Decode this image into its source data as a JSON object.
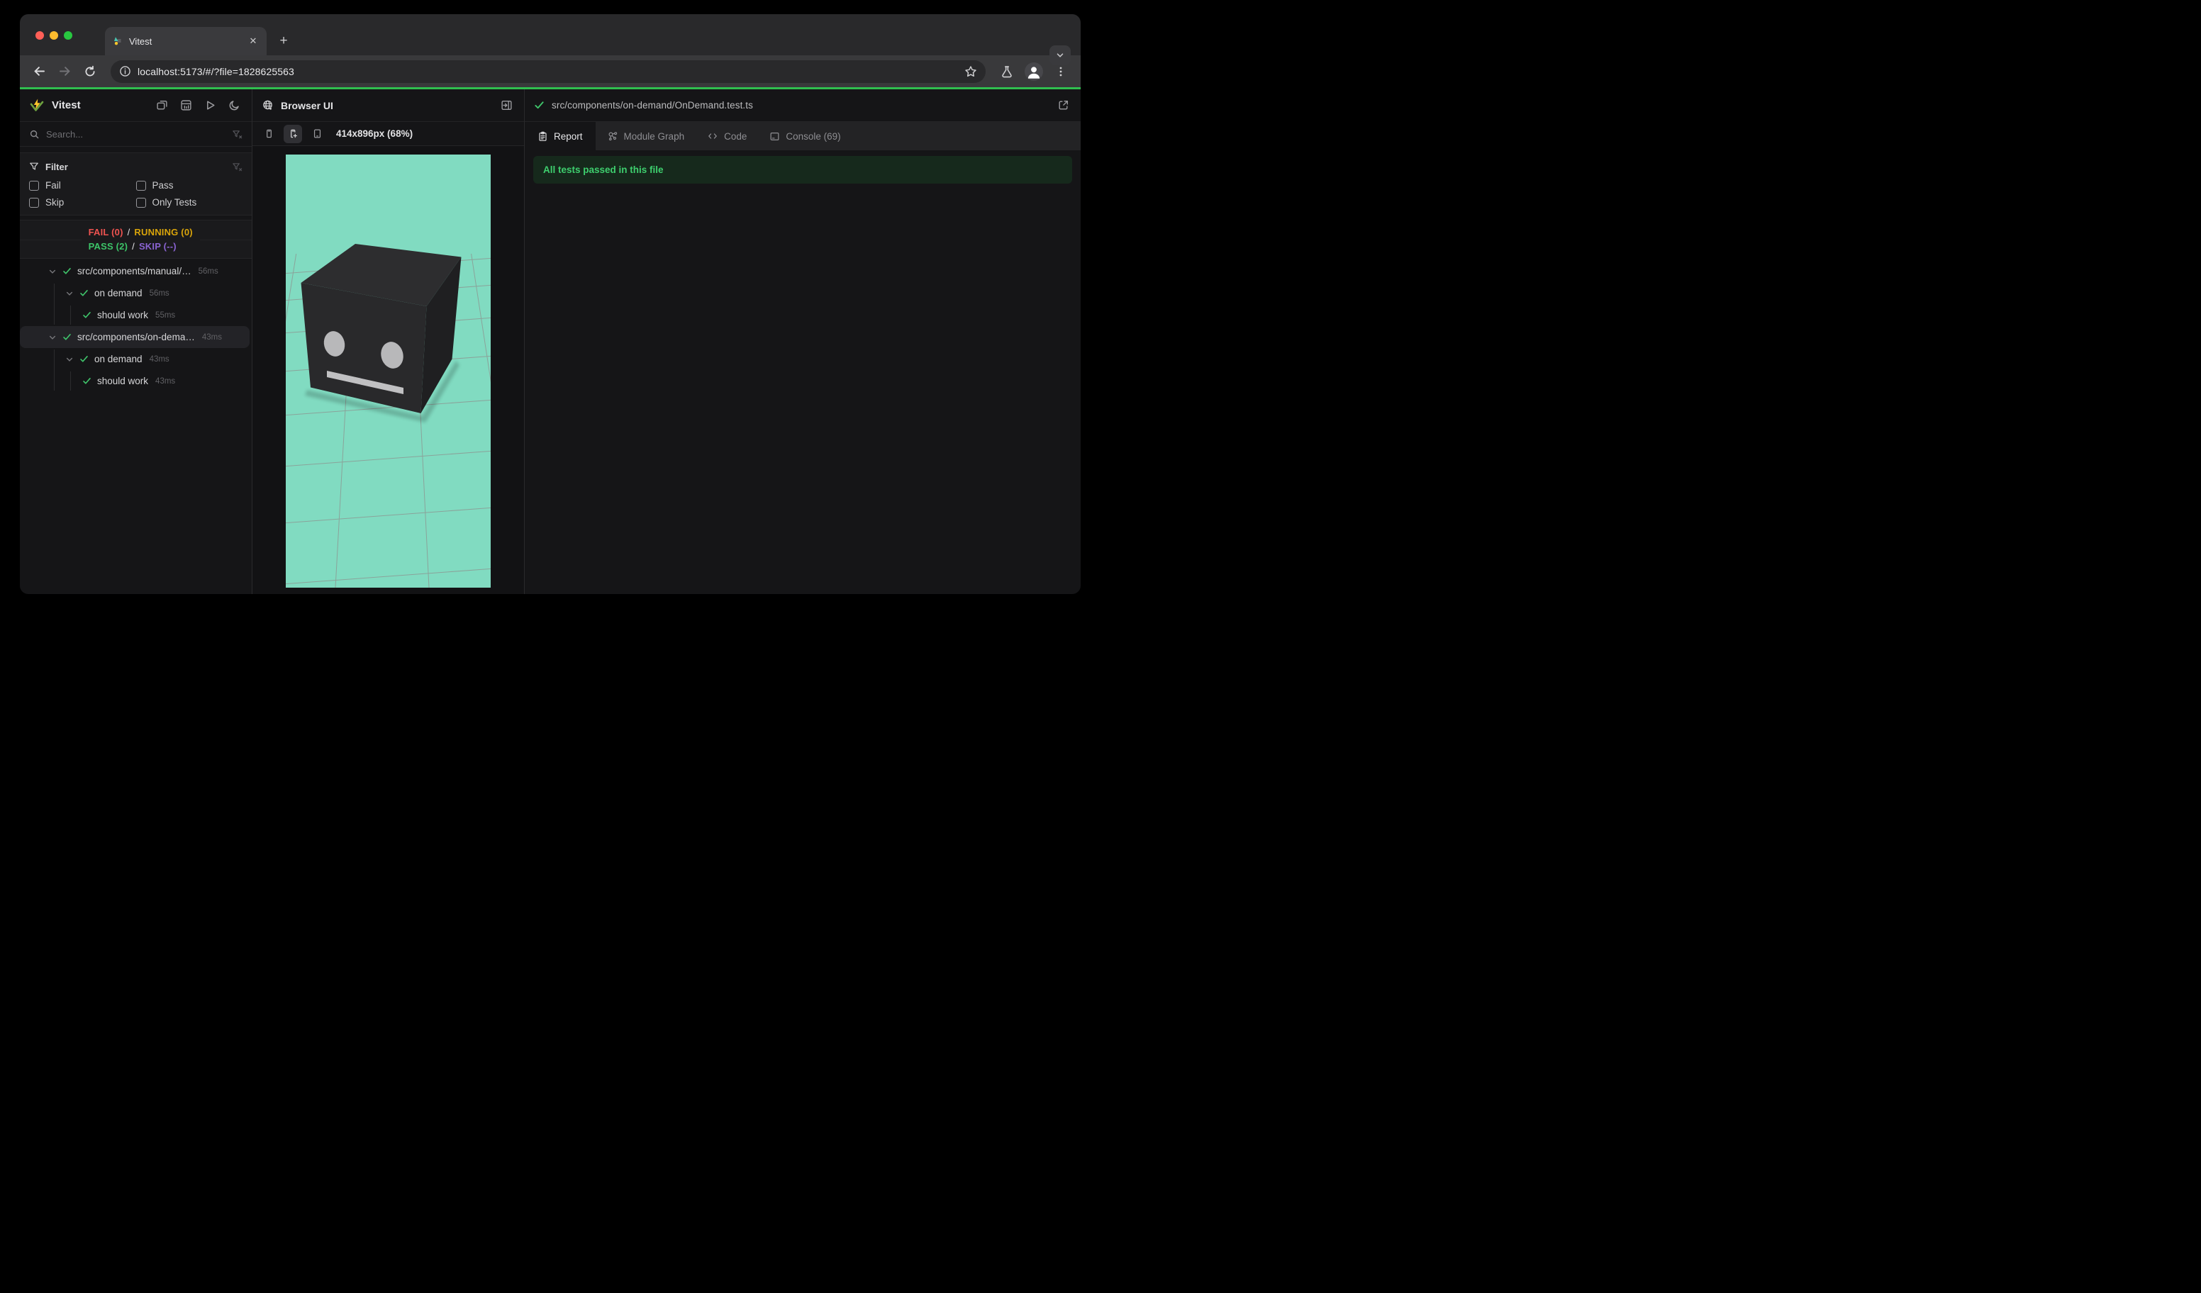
{
  "browser": {
    "tab_title": "Vitest",
    "close_glyph": "✕",
    "newtab_glyph": "+",
    "url": "localhost:5173/#/?file=1828625563"
  },
  "sidebar": {
    "app_title": "Vitest",
    "search_placeholder": "Search...",
    "filter": {
      "title": "Filter",
      "options": [
        {
          "label": "Fail"
        },
        {
          "label": "Pass"
        },
        {
          "label": "Skip"
        },
        {
          "label": "Only Tests"
        }
      ]
    },
    "status": {
      "fail": "FAIL (0)",
      "running": "RUNNING (0)",
      "pass": "PASS (2)",
      "skip": "SKIP (--)",
      "sep": "/"
    },
    "tree": [
      {
        "label": "src/components/manual/…",
        "time": "56ms"
      },
      {
        "label": "on demand",
        "time": "56ms"
      },
      {
        "label": "should work",
        "time": "55ms"
      },
      {
        "label": "src/components/on-dema…",
        "time": "43ms"
      },
      {
        "label": "on demand",
        "time": "43ms"
      },
      {
        "label": "should work",
        "time": "43ms"
      }
    ]
  },
  "browser_panel": {
    "title": "Browser UI",
    "viewport_label": "414x896px (68%)"
  },
  "report_panel": {
    "file_path": "src/components/on-demand/OnDemand.test.ts",
    "tabs": {
      "report": "Report",
      "module_graph": "Module Graph",
      "code": "Code",
      "console": "Console (69)"
    },
    "banner": "All tests passed in this file"
  },
  "colors": {
    "accent_green": "#30bf4f",
    "check_green": "#3fc56b",
    "fail_red": "#ef5350",
    "running_amber": "#d9a40a",
    "pass_green": "#3cc468",
    "skip_purple": "#8a63d2",
    "banner_bg": "#16291c",
    "banner_text": "#3ecf6e",
    "mint": "#81dbc1",
    "cube_front": "#29292b",
    "cube_top": "#2d2d2f",
    "cube_right": "#1f1f21",
    "cube_eye": "#b8b8ba",
    "grid_line": "#8c9a94",
    "traffic_red": "#ff5f57",
    "traffic_yellow": "#febc2e",
    "traffic_green": "#28c840"
  }
}
